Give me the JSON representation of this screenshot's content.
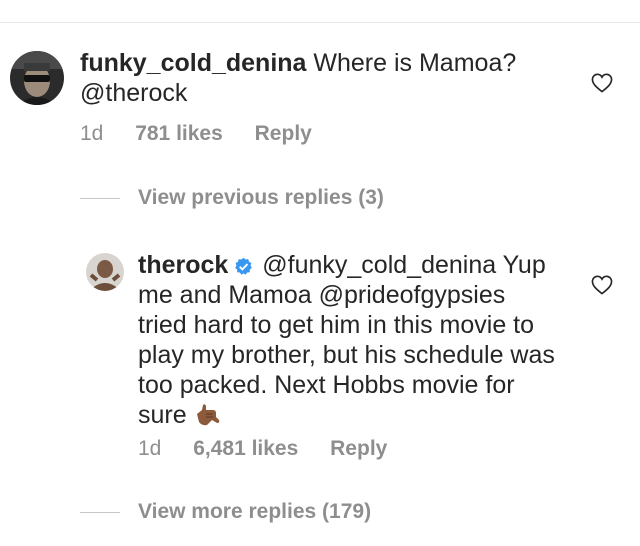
{
  "comments": [
    {
      "username": "funky_cold_denina",
      "text": "Where is Mamoa? @therock",
      "time": "1d",
      "likes": "781 likes",
      "reply": "Reply",
      "avatar_icon": "profile-photo-icon",
      "like_icon": "heart-outline-icon"
    },
    {
      "username": "therock",
      "verified": true,
      "verified_color": "#3897f0",
      "text": "@funky_cold_denina Yup me and Mamoa @prideofgypsies tried hard to get him in this movie to play my brother, but his schedule was too packed. Next Hobbs movie for sure",
      "emoji": "call-me-hand-emoji",
      "time": "1d",
      "likes": "6,481 likes",
      "reply": "Reply",
      "avatar_icon": "profile-photo-icon",
      "like_icon": "heart-outline-icon"
    }
  ],
  "view_previous_replies": "View previous replies (3)",
  "view_more_replies": "View more replies (179)",
  "colors": {
    "text": "#262626",
    "secondary": "#8e8e8e",
    "divider": "#c7c7c7"
  }
}
